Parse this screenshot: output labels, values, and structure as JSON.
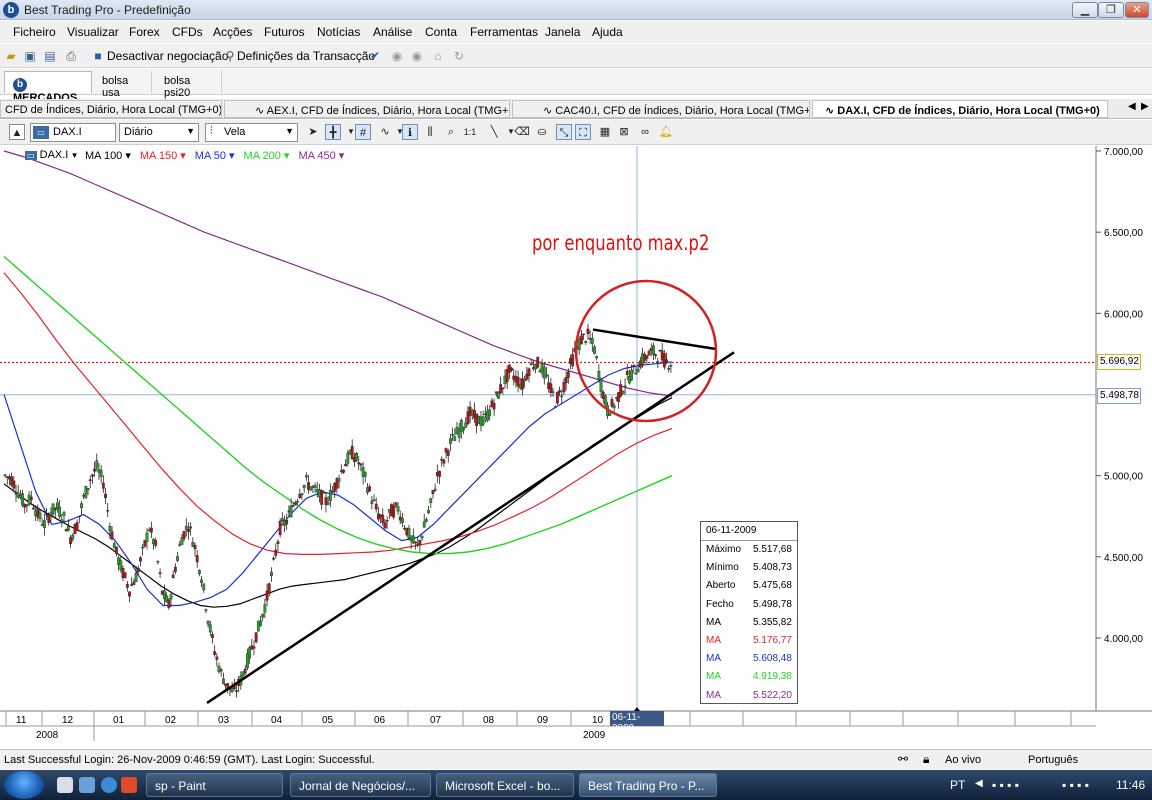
{
  "window": {
    "title": "Best Trading Pro - Predefinição",
    "app_icon": "b",
    "controls": [
      "minimize-icon",
      "maximize-icon",
      "close-icon"
    ]
  },
  "menu": [
    "Ficheiro",
    "Visualizar",
    "Forex",
    "CFDs",
    "Acções",
    "Futuros",
    "Notícias",
    "Análise",
    "Conta",
    "Ferramentas",
    "Janela",
    "Ajuda"
  ],
  "toolbar": {
    "deactivate_label": "Desactivar negociação",
    "settings_label": "Definições da Transacção"
  },
  "market_tabs": [
    {
      "label": "MERCADOS",
      "active": true
    },
    {
      "label": "bolsa usa",
      "active": false
    },
    {
      "label": "bolsa psi20",
      "active": false
    }
  ],
  "chart_tabs": [
    {
      "label": "CFD de Índices, Diário, Hora Local (TMG+0)",
      "active": false
    },
    {
      "label": "AEX.I, CFD de Índices, Diário, Hora Local (TMG+0)",
      "active": false
    },
    {
      "label": "CAC40.I, CFD de Índices, Diário, Hora Local (TMG+0)",
      "active": false
    },
    {
      "label": "DAX.I, CFD de Índices, Diário, Hora Local (TMG+0)",
      "active": true
    }
  ],
  "chart_toolbar": {
    "symbol": "DAX.I",
    "interval": "Diário",
    "chart_type": "Vela"
  },
  "legend": {
    "symbol": "DAX.I",
    "items": [
      {
        "label": "MA 100",
        "color": "#000000"
      },
      {
        "label": "MA 150",
        "color": "#e8202a"
      },
      {
        "label": "MA 50",
        "color": "#1a2fd0"
      },
      {
        "label": "MA 200",
        "color": "#22d422"
      },
      {
        "label": "MA 450",
        "color": "#8a2c8a"
      }
    ]
  },
  "annotation": "por enquanto max.p2",
  "chart_data": {
    "type": "candlestick",
    "y_axis": {
      "ticks": [
        {
          "label": "7.000,00",
          "value": 7000
        },
        {
          "label": "6.500,00",
          "value": 6500
        },
        {
          "label": "6.000,00",
          "value": 6000
        },
        {
          "label": "5.000,00",
          "value": 5000
        },
        {
          "label": "4.500,00",
          "value": 4500
        },
        {
          "label": "4.000,00",
          "value": 4000
        }
      ],
      "range": [
        3600,
        7050
      ]
    },
    "x_axis": {
      "months": [
        "11",
        "12",
        "01",
        "02",
        "03",
        "04",
        "05",
        "06",
        "07",
        "08",
        "09",
        "10",
        "06-11-2009"
      ],
      "years": [
        "2008",
        "2009"
      ]
    },
    "price_marker": {
      "label": "5.696,92",
      "value": 5696.92
    },
    "cursor_marker": {
      "label": "5.498,78",
      "value": 5498.78,
      "date": "06-11-2009"
    },
    "close_series": [
      5000,
      4980,
      4900,
      4820,
      4860,
      4760,
      4700,
      4780,
      4800,
      4740,
      4620,
      4700,
      4860,
      4980,
      5050,
      4960,
      4700,
      4520,
      4400,
      4300,
      4380,
      4520,
      4680,
      4560,
      4280,
      4200,
      4440,
      4620,
      4700,
      4560,
      4380,
      4120,
      3920,
      3780,
      3700,
      3660,
      3740,
      3860,
      3980,
      4100,
      4250,
      4450,
      4680,
      4720,
      4820,
      4900,
      4960,
      4920,
      4880,
      4840,
      4900,
      5000,
      5080,
      5140,
      5080,
      4980,
      4860,
      4760,
      4700,
      4780,
      4800,
      4700,
      4600,
      4560,
      4680,
      4820,
      5000,
      5100,
      5200,
      5260,
      5320,
      5380,
      5350,
      5330,
      5400,
      5480,
      5560,
      5640,
      5600,
      5560,
      5660,
      5700,
      5660,
      5560,
      5460,
      5520,
      5640,
      5760,
      5840,
      5860,
      5780,
      5560,
      5400,
      5440,
      5520,
      5600,
      5640,
      5700,
      5740,
      5760,
      5740,
      5700
    ],
    "ma_series": {
      "MA 100": [
        4950,
        4890,
        4830,
        4780,
        4735,
        4690,
        4650,
        4610,
        4560,
        4500,
        4440,
        4380,
        4320,
        4270,
        4230,
        4200,
        4190,
        4195,
        4210,
        4240,
        4270,
        4300,
        4320,
        4330,
        4340,
        4350,
        4360,
        4380,
        4400,
        4420,
        4440,
        4460,
        4490,
        4520,
        4560,
        4610,
        4660,
        4720,
        4780,
        4840,
        4900,
        4960,
        5020,
        5080,
        5130,
        5190,
        5240,
        5290,
        5340,
        5390,
        5440,
        5480
      ],
      "MA 150": [
        6250,
        6120,
        5980,
        5830,
        5690,
        5560,
        5430,
        5300,
        5170,
        5040,
        4920,
        4810,
        4720,
        4640,
        4580,
        4540,
        4520,
        4515,
        4515,
        4520,
        4525,
        4530,
        4540,
        4560,
        4580,
        4600,
        4625,
        4660,
        4700,
        4750,
        4800,
        4860,
        4930,
        5000,
        5070,
        5140,
        5200,
        5250,
        5290
      ],
      "MA 50": [
        5500,
        5200,
        4900,
        4700,
        4720,
        4760,
        4700,
        4600,
        4460,
        4300,
        4200,
        4200,
        4220,
        4250,
        4300,
        4400,
        4520,
        4640,
        4760,
        4860,
        4900,
        4880,
        4820,
        4740,
        4660,
        4600,
        4620,
        4700,
        4800,
        4900,
        5000,
        5100,
        5200,
        5300,
        5380,
        5440,
        5500,
        5560,
        5620,
        5660,
        5680,
        5690,
        5700
      ],
      "MA 200": [
        6350,
        6250,
        6150,
        6050,
        5950,
        5850,
        5750,
        5650,
        5550,
        5450,
        5350,
        5250,
        5150,
        5050,
        4960,
        4880,
        4800,
        4730,
        4670,
        4620,
        4580,
        4550,
        4530,
        4520,
        4520,
        4530,
        4550,
        4580,
        4620,
        4660,
        4700,
        4750,
        4800,
        4850,
        4900,
        4950,
        5000
      ],
      "MA 450": [
        7000,
        6960,
        6910,
        6860,
        6800,
        6740,
        6680,
        6620,
        6560,
        6500,
        6450,
        6400,
        6350,
        6300,
        6250,
        6200,
        6150,
        6100,
        6040,
        5980,
        5920,
        5860,
        5800,
        5750,
        5700,
        5660,
        5620,
        5580,
        5540,
        5510,
        5490
      ]
    },
    "trendlines": [
      {
        "from": [
          "2009-03-06",
          3600
        ],
        "to": [
          "2009-11-26",
          5760
        ]
      },
      {
        "from": [
          "2009-10-06",
          5900
        ],
        "to": [
          "2009-11-26",
          5780
        ]
      }
    ]
  },
  "databox": {
    "date": "06-11-2009",
    "rows": [
      {
        "label": "Máximo",
        "value": "5.517,68",
        "color": "#000000"
      },
      {
        "label": "Mínimo",
        "value": "5.408,73",
        "color": "#000000"
      },
      {
        "label": "Aberto",
        "value": "5.475,68",
        "color": "#000000"
      },
      {
        "label": "Fecho",
        "value": "5.498,78",
        "color": "#000000"
      },
      {
        "label": "MA",
        "value": "5.355,82",
        "color": "#000000"
      },
      {
        "label": "MA",
        "value": "5.176,77",
        "color": "#e8202a"
      },
      {
        "label": "MA",
        "value": "5.608,48",
        "color": "#1a2fd0"
      },
      {
        "label": "MA",
        "value": "4.919,38",
        "color": "#22d422"
      },
      {
        "label": "MA",
        "value": "5.522,20",
        "color": "#8a2c8a"
      }
    ]
  },
  "status": {
    "login": "Last Successful Login: 26-Nov-2009 0:46:59 (GMT). Last Login: Successful.",
    "live": "Ao vivo",
    "language": "Português"
  },
  "taskbar": {
    "tasks": [
      {
        "label": "sp - Paint",
        "active": false
      },
      {
        "label": "Jornal de Negócios/...",
        "active": false
      },
      {
        "label": "Microsoft Excel - bo...",
        "active": false
      },
      {
        "label": "Best Trading Pro - P...",
        "active": true
      }
    ],
    "lang": "PT",
    "clock": "11:46"
  }
}
